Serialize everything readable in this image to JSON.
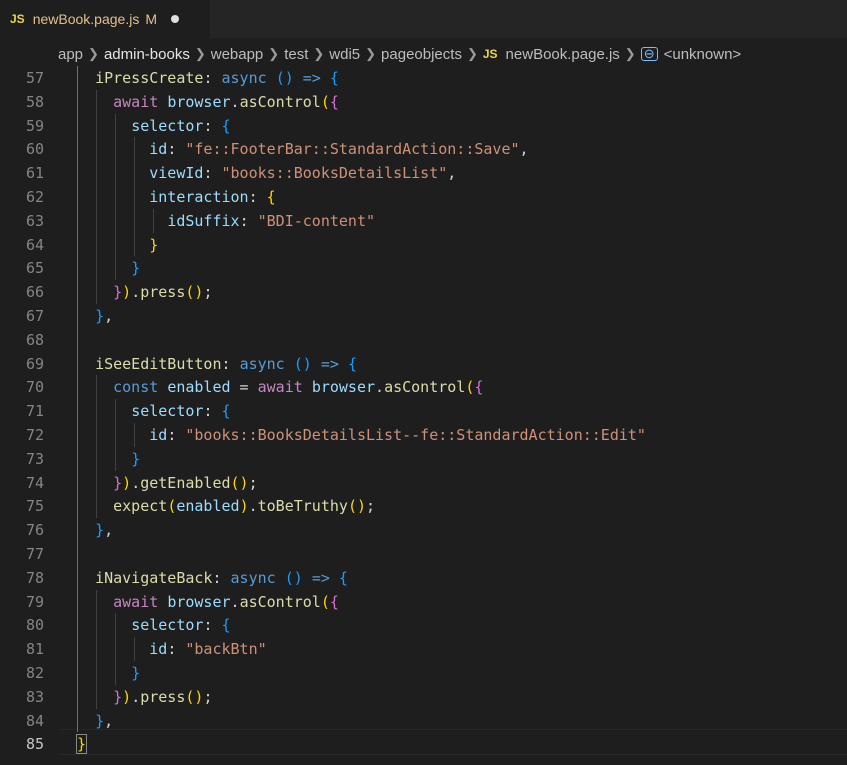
{
  "tab": {
    "badge": "JS",
    "filename": "newBook.page.js",
    "status": "M"
  },
  "breadcrumb": {
    "items": [
      "app",
      "admin-books",
      "webapp",
      "test",
      "wdi5",
      "pageobjects"
    ],
    "file_badge": "JS",
    "file": "newBook.page.js",
    "symbol": "<unknown>"
  },
  "colors": {
    "background": "#1e1e1e",
    "function": "#dcdcaa",
    "keyword": "#569cd6",
    "control": "#c586c0",
    "variable": "#9cdcfe",
    "string": "#ce9178",
    "bracket1": "#ffd700",
    "bracket2": "#da70d6",
    "bracket3": "#179fff"
  },
  "editor": {
    "current_line": 85,
    "lines": [
      {
        "n": "57",
        "indent": "  ",
        "tokens": [
          {
            "t": "iPressCreate",
            "c": "fn"
          },
          {
            "t": ": ",
            "c": "pl"
          },
          {
            "t": "async",
            "c": "kw"
          },
          {
            "t": " ",
            "c": "pl"
          },
          {
            "t": "()",
            "c": "p3"
          },
          {
            "t": " ",
            "c": "pl"
          },
          {
            "t": "=>",
            "c": "kw"
          },
          {
            "t": " ",
            "c": "pl"
          },
          {
            "t": "{",
            "c": "p3"
          }
        ]
      },
      {
        "n": "58",
        "indent": "    ",
        "tokens": [
          {
            "t": "await",
            "c": "ctl"
          },
          {
            "t": " ",
            "c": "pl"
          },
          {
            "t": "browser",
            "c": "var"
          },
          {
            "t": ".",
            "c": "pl"
          },
          {
            "t": "asControl",
            "c": "fn"
          },
          {
            "t": "(",
            "c": "p1"
          },
          {
            "t": "{",
            "c": "p2"
          }
        ]
      },
      {
        "n": "59",
        "indent": "      ",
        "tokens": [
          {
            "t": "selector",
            "c": "var"
          },
          {
            "t": ": ",
            "c": "pl"
          },
          {
            "t": "{",
            "c": "p3"
          }
        ]
      },
      {
        "n": "60",
        "indent": "        ",
        "tokens": [
          {
            "t": "id",
            "c": "var"
          },
          {
            "t": ": ",
            "c": "pl"
          },
          {
            "t": "\"fe::FooterBar::StandardAction::Save\"",
            "c": "str"
          },
          {
            "t": ",",
            "c": "pl"
          }
        ]
      },
      {
        "n": "61",
        "indent": "        ",
        "tokens": [
          {
            "t": "viewId",
            "c": "var"
          },
          {
            "t": ": ",
            "c": "pl"
          },
          {
            "t": "\"books::BooksDetailsList\"",
            "c": "str"
          },
          {
            "t": ",",
            "c": "pl"
          }
        ]
      },
      {
        "n": "62",
        "indent": "        ",
        "tokens": [
          {
            "t": "interaction",
            "c": "var"
          },
          {
            "t": ": ",
            "c": "pl"
          },
          {
            "t": "{",
            "c": "p1"
          }
        ]
      },
      {
        "n": "63",
        "indent": "          ",
        "tokens": [
          {
            "t": "idSuffix",
            "c": "var"
          },
          {
            "t": ": ",
            "c": "pl"
          },
          {
            "t": "\"BDI-content\"",
            "c": "str"
          }
        ]
      },
      {
        "n": "64",
        "indent": "        ",
        "tokens": [
          {
            "t": "}",
            "c": "p1"
          }
        ]
      },
      {
        "n": "65",
        "indent": "      ",
        "tokens": [
          {
            "t": "}",
            "c": "p3"
          }
        ]
      },
      {
        "n": "66",
        "indent": "    ",
        "tokens": [
          {
            "t": "}",
            "c": "p2"
          },
          {
            "t": ")",
            "c": "p1"
          },
          {
            "t": ".",
            "c": "pl"
          },
          {
            "t": "press",
            "c": "fn"
          },
          {
            "t": "()",
            "c": "p1"
          },
          {
            "t": ";",
            "c": "pl"
          }
        ]
      },
      {
        "n": "67",
        "indent": "  ",
        "tokens": [
          {
            "t": "}",
            "c": "p3"
          },
          {
            "t": ",",
            "c": "pl"
          }
        ]
      },
      {
        "n": "68",
        "indent": "",
        "tokens": []
      },
      {
        "n": "69",
        "indent": "  ",
        "tokens": [
          {
            "t": "iSeeEditButton",
            "c": "fn"
          },
          {
            "t": ": ",
            "c": "pl"
          },
          {
            "t": "async",
            "c": "kw"
          },
          {
            "t": " ",
            "c": "pl"
          },
          {
            "t": "()",
            "c": "p3"
          },
          {
            "t": " ",
            "c": "pl"
          },
          {
            "t": "=>",
            "c": "kw"
          },
          {
            "t": " ",
            "c": "pl"
          },
          {
            "t": "{",
            "c": "p3"
          }
        ]
      },
      {
        "n": "70",
        "indent": "    ",
        "tokens": [
          {
            "t": "const",
            "c": "kw"
          },
          {
            "t": " ",
            "c": "pl"
          },
          {
            "t": "enabled",
            "c": "var"
          },
          {
            "t": " = ",
            "c": "pl"
          },
          {
            "t": "await",
            "c": "ctl"
          },
          {
            "t": " ",
            "c": "pl"
          },
          {
            "t": "browser",
            "c": "var"
          },
          {
            "t": ".",
            "c": "pl"
          },
          {
            "t": "asControl",
            "c": "fn"
          },
          {
            "t": "(",
            "c": "p1"
          },
          {
            "t": "{",
            "c": "p2"
          }
        ]
      },
      {
        "n": "71",
        "indent": "      ",
        "tokens": [
          {
            "t": "selector",
            "c": "var"
          },
          {
            "t": ": ",
            "c": "pl"
          },
          {
            "t": "{",
            "c": "p3"
          }
        ]
      },
      {
        "n": "72",
        "indent": "        ",
        "tokens": [
          {
            "t": "id",
            "c": "var"
          },
          {
            "t": ": ",
            "c": "pl"
          },
          {
            "t": "\"books::BooksDetailsList--fe::StandardAction::Edit\"",
            "c": "str"
          }
        ]
      },
      {
        "n": "73",
        "indent": "      ",
        "tokens": [
          {
            "t": "}",
            "c": "p3"
          }
        ]
      },
      {
        "n": "74",
        "indent": "    ",
        "tokens": [
          {
            "t": "}",
            "c": "p2"
          },
          {
            "t": ")",
            "c": "p1"
          },
          {
            "t": ".",
            "c": "pl"
          },
          {
            "t": "getEnabled",
            "c": "fn"
          },
          {
            "t": "()",
            "c": "p1"
          },
          {
            "t": ";",
            "c": "pl"
          }
        ]
      },
      {
        "n": "75",
        "indent": "    ",
        "tokens": [
          {
            "t": "expect",
            "c": "fn"
          },
          {
            "t": "(",
            "c": "p1"
          },
          {
            "t": "enabled",
            "c": "var"
          },
          {
            "t": ")",
            "c": "p1"
          },
          {
            "t": ".",
            "c": "pl"
          },
          {
            "t": "toBeTruthy",
            "c": "fn"
          },
          {
            "t": "()",
            "c": "p1"
          },
          {
            "t": ";",
            "c": "pl"
          }
        ]
      },
      {
        "n": "76",
        "indent": "  ",
        "tokens": [
          {
            "t": "}",
            "c": "p3"
          },
          {
            "t": ",",
            "c": "pl"
          }
        ]
      },
      {
        "n": "77",
        "indent": "",
        "tokens": []
      },
      {
        "n": "78",
        "indent": "  ",
        "tokens": [
          {
            "t": "iNavigateBack",
            "c": "fn"
          },
          {
            "t": ": ",
            "c": "pl"
          },
          {
            "t": "async",
            "c": "kw"
          },
          {
            "t": " ",
            "c": "pl"
          },
          {
            "t": "()",
            "c": "p3"
          },
          {
            "t": " ",
            "c": "pl"
          },
          {
            "t": "=>",
            "c": "kw"
          },
          {
            "t": " ",
            "c": "pl"
          },
          {
            "t": "{",
            "c": "p3"
          }
        ]
      },
      {
        "n": "79",
        "indent": "    ",
        "tokens": [
          {
            "t": "await",
            "c": "ctl"
          },
          {
            "t": " ",
            "c": "pl"
          },
          {
            "t": "browser",
            "c": "var"
          },
          {
            "t": ".",
            "c": "pl"
          },
          {
            "t": "asControl",
            "c": "fn"
          },
          {
            "t": "(",
            "c": "p1"
          },
          {
            "t": "{",
            "c": "p2"
          }
        ]
      },
      {
        "n": "80",
        "indent": "      ",
        "tokens": [
          {
            "t": "selector",
            "c": "var"
          },
          {
            "t": ": ",
            "c": "pl"
          },
          {
            "t": "{",
            "c": "p3"
          }
        ]
      },
      {
        "n": "81",
        "indent": "        ",
        "tokens": [
          {
            "t": "id",
            "c": "var"
          },
          {
            "t": ": ",
            "c": "pl"
          },
          {
            "t": "\"backBtn\"",
            "c": "str"
          }
        ]
      },
      {
        "n": "82",
        "indent": "      ",
        "tokens": [
          {
            "t": "}",
            "c": "p3"
          }
        ]
      },
      {
        "n": "83",
        "indent": "    ",
        "tokens": [
          {
            "t": "}",
            "c": "p2"
          },
          {
            "t": ")",
            "c": "p1"
          },
          {
            "t": ".",
            "c": "pl"
          },
          {
            "t": "press",
            "c": "fn"
          },
          {
            "t": "()",
            "c": "p1"
          },
          {
            "t": ";",
            "c": "pl"
          }
        ]
      },
      {
        "n": "84",
        "indent": "  ",
        "tokens": [
          {
            "t": "}",
            "c": "p3"
          },
          {
            "t": ",",
            "c": "pl"
          }
        ]
      },
      {
        "n": "85",
        "indent": "",
        "tokens": [
          {
            "t": "}",
            "c": "p1"
          }
        ]
      }
    ]
  }
}
